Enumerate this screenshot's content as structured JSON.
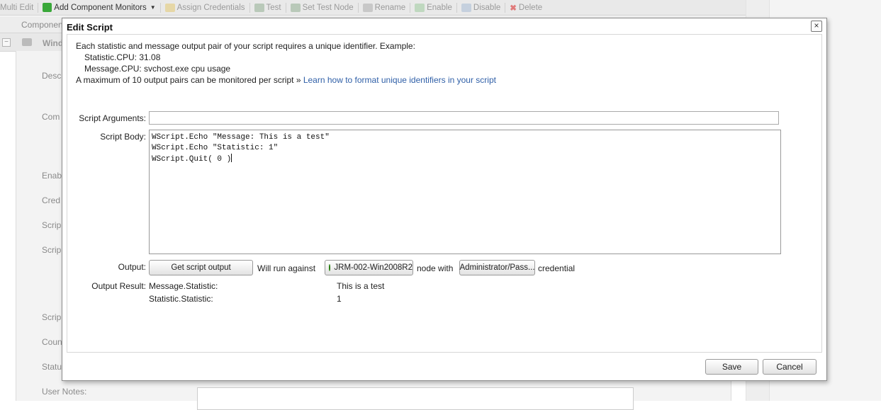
{
  "background": {
    "toolbar": [
      {
        "label": "Multi Edit",
        "active": false
      },
      {
        "label": "Add Component Monitors",
        "active": true,
        "icon": "plus-icon",
        "has_dropdown": true
      },
      {
        "label": "Assign Credentials",
        "active": false,
        "icon": "key-icon"
      },
      {
        "label": "Test",
        "active": false,
        "icon": "test-icon"
      },
      {
        "label": "Set Test Node",
        "active": false,
        "icon": "node-icon"
      },
      {
        "label": "Rename",
        "active": false,
        "icon": "rename-icon"
      },
      {
        "label": "Enable",
        "active": false,
        "icon": "enable-icon"
      },
      {
        "label": "Disable",
        "active": false,
        "icon": "disable-icon"
      },
      {
        "label": "Delete",
        "active": false,
        "icon": "delete-icon"
      }
    ],
    "column_header": "Componen",
    "row_label": "Wind",
    "side_labels": [
      "Desc",
      "Com",
      "Enab",
      "Cred",
      "Scrip",
      "Scrip",
      "Scrip",
      "Coun",
      "Statu"
    ],
    "user_notes_label": "User Notes:"
  },
  "dialog": {
    "title": "Edit Script",
    "info": {
      "line1": "Each statistic and message output pair of your script requires a unique identifier. Example:",
      "example_statistic": "Statistic.CPU: 31.08",
      "example_message": "Message.CPU: svchost.exe cpu usage",
      "line4": "A maximum of 10 output pairs can be monitored per script » ",
      "link": "Learn how to format unique identifiers in your script"
    },
    "script_arguments_label": "Script Arguments:",
    "script_arguments_value": "",
    "script_body_label": "Script Body:",
    "script_body_lines": [
      "WScript.Echo \"Message: This is a test\"",
      "WScript.Echo \"Statistic: 1\"",
      "WScript.Quit( 0 )"
    ],
    "output_label": "Output:",
    "get_output_button": "Get script output",
    "will_run_against": "Will run against",
    "node_name": "JRM-002-Win2008R2",
    "node_with": "node with",
    "credential_button": "Administrator/Pass...",
    "credential_text": "credential",
    "output_result_label": "Output Result:",
    "results": [
      {
        "name": "Message.Statistic:",
        "value": "This is a test"
      },
      {
        "name": "Statistic.Statistic:",
        "value": "1"
      }
    ],
    "save_button": "Save",
    "cancel_button": "Cancel"
  },
  "colors": {
    "link": "#2f5fa7",
    "node_status": "#2c9a12"
  }
}
